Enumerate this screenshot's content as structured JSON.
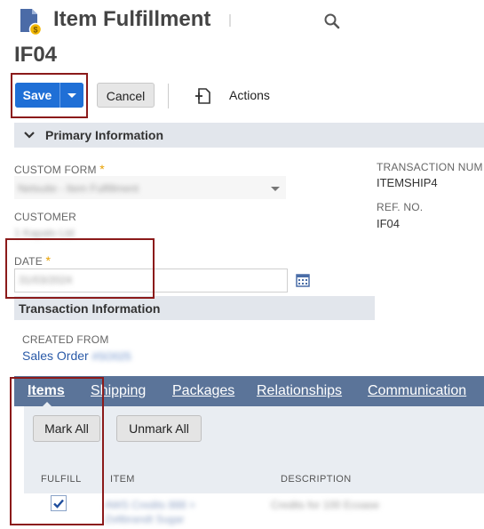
{
  "page": {
    "title": "Item Fulfillment",
    "record_id": "IF04"
  },
  "actions_bar": {
    "save_label": "Save",
    "cancel_label": "Cancel",
    "actions_label": "Actions"
  },
  "primary_section": {
    "title": "Primary Information",
    "custom_form_label": "CUSTOM FORM",
    "custom_form_value": "Netsuite - Item Fulfillment",
    "customer_label": "CUSTOMER",
    "customer_value": "1 Kapalo Ltd",
    "date_label": "DATE",
    "date_value": "31/03/2024",
    "transaction_number_label": "TRANSACTION NUM",
    "transaction_number_value": "ITEMSHIP4",
    "ref_no_label": "REF. NO.",
    "ref_no_value": "IF04",
    "required_mark": "*"
  },
  "transaction_section": {
    "title": "Transaction Information",
    "created_from_label": "CREATED FROM",
    "created_from_link": "Sales Order",
    "created_from_number": "#SO025"
  },
  "subtabs": [
    {
      "label": "Items",
      "active": true
    },
    {
      "label": "Shipping",
      "active": false
    },
    {
      "label": "Packages",
      "active": false
    },
    {
      "label": "Relationships",
      "active": false
    },
    {
      "label": "Communication",
      "active": false
    }
  ],
  "items_tab": {
    "mark_all_label": "Mark All",
    "unmark_all_label": "Unmark All",
    "columns": [
      "FULFILL",
      "ITEM",
      "DESCRIPTION"
    ],
    "rows": [
      {
        "fulfill": true,
        "item_line1": "AWS Credits 888 > ",
        "item_line2": "Zeltbrandt Sugar",
        "description": "Credits for 100 Ecoase"
      }
    ]
  },
  "colors": {
    "primary_button": "#1f6fd6",
    "subtab_bar": "#5b7499",
    "section_bar": "#e2e6ec",
    "highlight_box": "#8b1a1a",
    "required_star": "#e8a000"
  }
}
